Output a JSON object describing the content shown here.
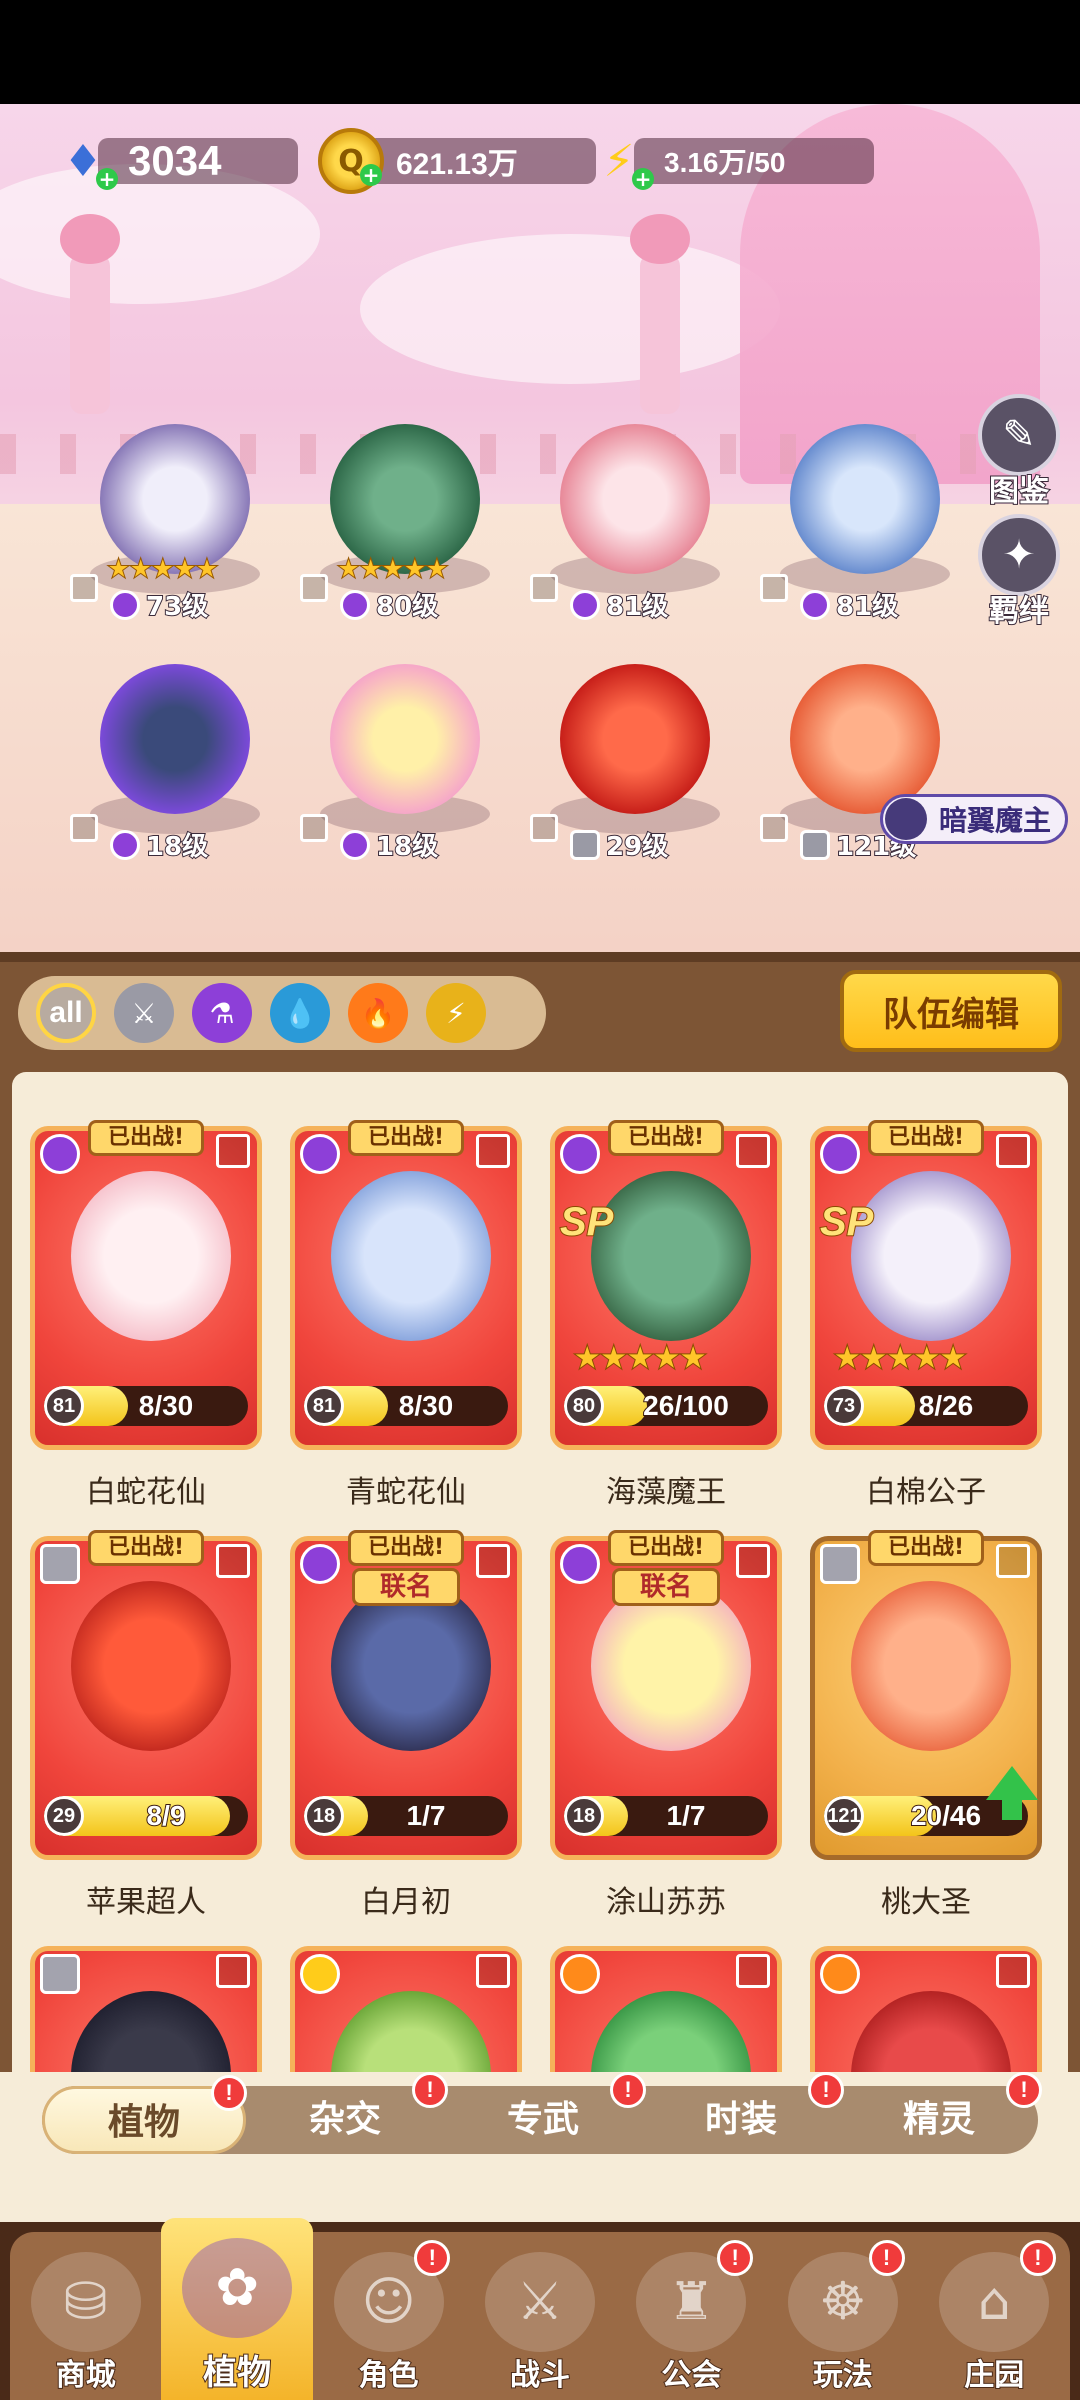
{
  "resources": {
    "gems": "3034",
    "coins": "621.13万",
    "energy": "3.16万/50"
  },
  "side_buttons": {
    "codex": "图鉴",
    "bond": "羁绊"
  },
  "formation": [
    {
      "level": "73级",
      "stars": "★★★★★",
      "type": "plant"
    },
    {
      "level": "80级",
      "stars": "★★★★★",
      "type": "plant"
    },
    {
      "level": "81级",
      "stars": "",
      "type": "plant"
    },
    {
      "level": "81级",
      "stars": "",
      "type": "plant"
    },
    {
      "level": "18级",
      "stars": "",
      "type": "plant"
    },
    {
      "level": "18级",
      "stars": "",
      "type": "plant"
    },
    {
      "level": "29级",
      "stars": "",
      "type": "sword"
    },
    {
      "level": "121级",
      "stars": "",
      "type": "sword"
    }
  ],
  "boss_tag": "暗翼魔主",
  "filters": {
    "all_label": "all",
    "team_edit": "队伍编辑"
  },
  "cards": [
    {
      "name": "白蛇花仙",
      "deployed": "已出战!",
      "level": "81",
      "count": "8/30",
      "progress": 0.267,
      "stars": "",
      "sp": "",
      "tag": ""
    },
    {
      "name": "青蛇花仙",
      "deployed": "已出战!",
      "level": "81",
      "count": "8/30",
      "progress": 0.267,
      "stars": "",
      "sp": "",
      "tag": ""
    },
    {
      "name": "海藻魔王",
      "deployed": "已出战!",
      "level": "80",
      "count": "26/100",
      "progress": 0.26,
      "stars": "★★★★★",
      "sp": "SP",
      "tag": ""
    },
    {
      "name": "白棉公子",
      "deployed": "已出战!",
      "level": "73",
      "count": "8/26",
      "progress": 0.308,
      "stars": "★★★★★",
      "sp": "SP",
      "tag": ""
    },
    {
      "name": "苹果超人",
      "deployed": "已出战!",
      "level": "29",
      "count": "8/9",
      "progress": 0.889,
      "stars": "",
      "sp": "",
      "tag": ""
    },
    {
      "name": "白月初",
      "deployed": "已出战!",
      "level": "18",
      "count": "1/7",
      "progress": 0.143,
      "stars": "",
      "sp": "",
      "tag": "联名"
    },
    {
      "name": "涂山苏苏",
      "deployed": "已出战!",
      "level": "18",
      "count": "1/7",
      "progress": 0.143,
      "stars": "",
      "sp": "",
      "tag": "联名"
    },
    {
      "name": "桃大圣",
      "deployed": "已出战!",
      "level": "121",
      "count": "20/46",
      "progress": 0.435,
      "stars": "",
      "sp": "",
      "tag": ""
    }
  ],
  "subtabs": [
    "植物",
    "杂交",
    "专武",
    "时装",
    "精灵"
  ],
  "badge_text": "!",
  "bottom_nav": [
    "商城",
    "植物",
    "角色",
    "战斗",
    "公会",
    "玩法",
    "庄园"
  ],
  "colors": {
    "accent": "#ffc629",
    "card_red": "#f0453c",
    "card_gold": "#f2b04a",
    "panel_brown": "#7d5535",
    "badge_red": "#f03b3b"
  }
}
